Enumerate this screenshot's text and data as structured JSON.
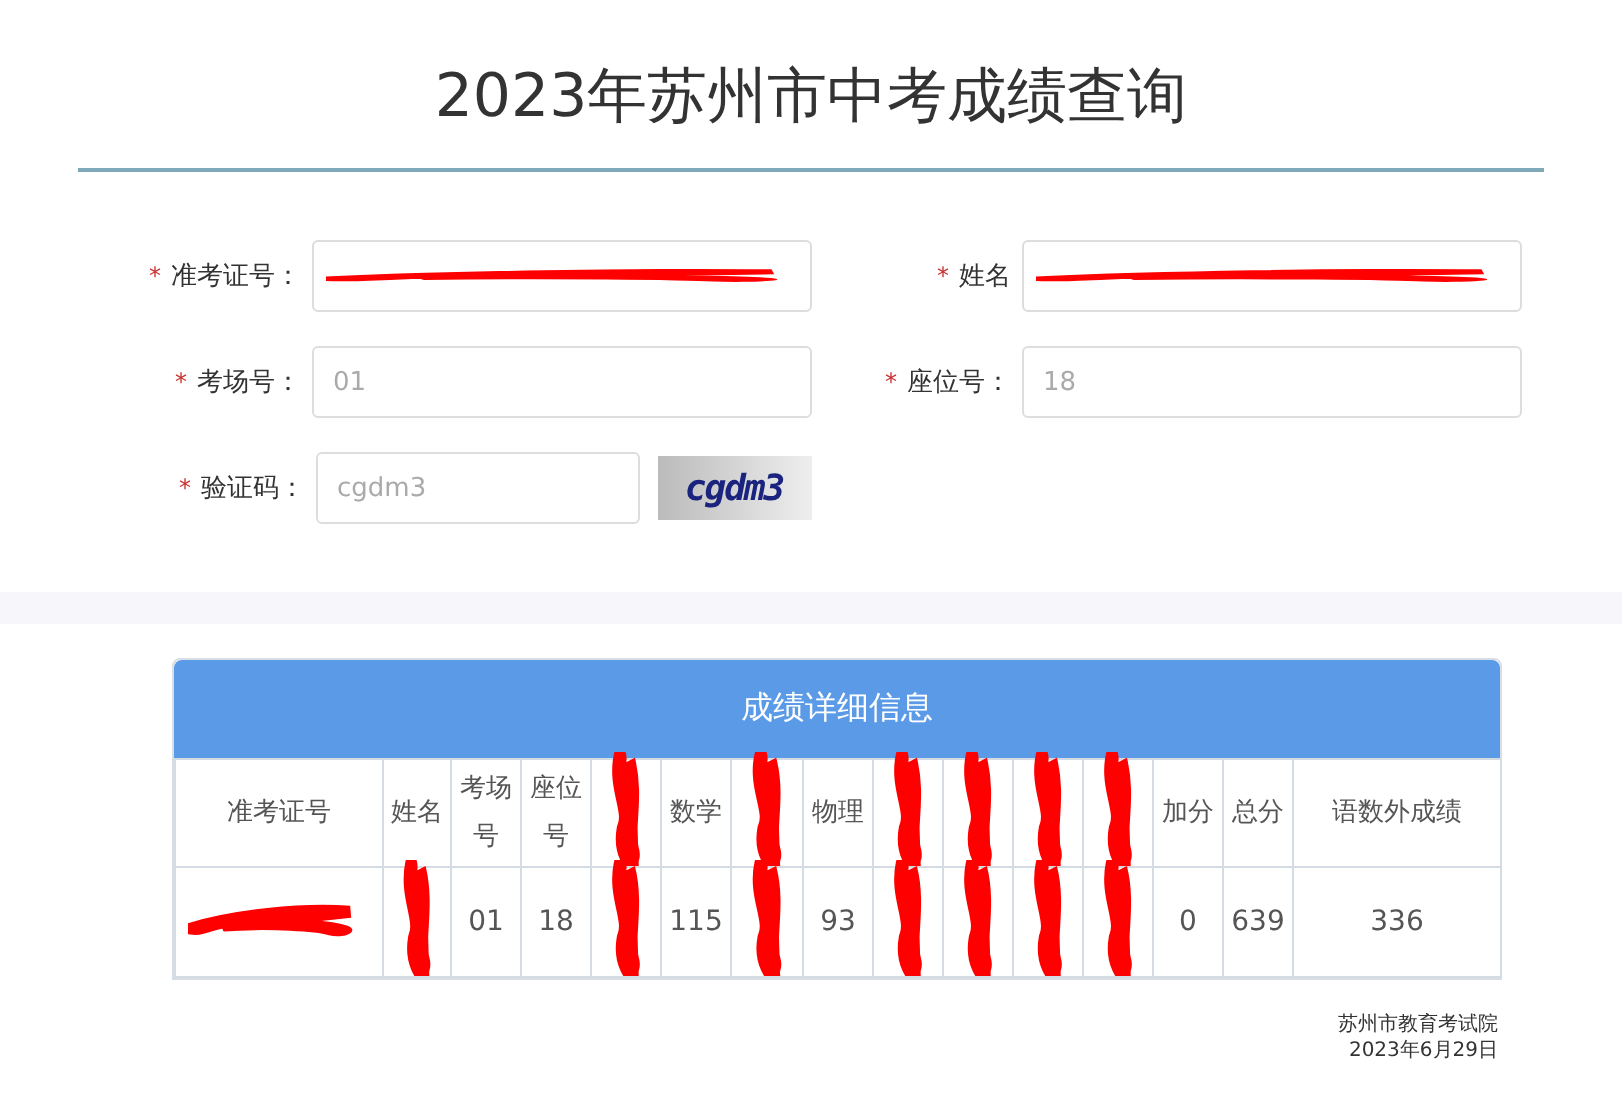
{
  "title": "2023年苏州市中考成绩查询",
  "form": {
    "fields": [
      {
        "marker": "*",
        "label": "准考证号：",
        "redacted": true
      },
      {
        "marker": "*",
        "label": "姓名",
        "redacted": true
      },
      {
        "marker": "*",
        "label": "考场号：",
        "value": "01",
        "redacted": false
      },
      {
        "marker": "*",
        "label": "座位号：",
        "value": "18",
        "redacted": false
      },
      {
        "marker": "*",
        "label": "验证码：",
        "value": "cgdm3",
        "redacted": false
      }
    ],
    "captcha_text": "cgdm3"
  },
  "results": {
    "title": "成绩详细信息",
    "columns": [
      {
        "header": "准考证号",
        "redacted": false
      },
      {
        "header": "姓名",
        "redacted": false
      },
      {
        "header": "考场号",
        "redacted": false
      },
      {
        "header": "座位号",
        "redacted": false
      },
      {
        "redacted": true
      },
      {
        "header": "数学",
        "redacted": false
      },
      {
        "redacted": true
      },
      {
        "header": "物理",
        "redacted": false
      },
      {
        "redacted": true
      },
      {
        "redacted": true
      },
      {
        "redacted": true
      },
      {
        "redacted": true
      },
      {
        "header": "加分",
        "redacted": false
      },
      {
        "header": "总分",
        "redacted": false
      },
      {
        "header": "语数外成绩",
        "redacted": false
      }
    ],
    "rows": [
      {
        "cells": [
          {
            "redacted": true
          },
          {
            "redacted": true
          },
          {
            "text": "01",
            "redacted": false
          },
          {
            "text": "18",
            "redacted": false
          },
          {
            "redacted": true
          },
          {
            "text": "115",
            "redacted": false
          },
          {
            "redacted": true
          },
          {
            "text": "93",
            "redacted": false
          },
          {
            "redacted": true
          },
          {
            "redacted": true
          },
          {
            "redacted": true
          },
          {
            "redacted": true
          },
          {
            "text": "0",
            "redacted": false
          },
          {
            "text": "639",
            "redacted": false
          },
          {
            "text": "336",
            "redacted": false
          }
        ]
      }
    ]
  },
  "footer": {
    "issuer": "苏州市教育考试院",
    "date": "2023年6月29日"
  }
}
